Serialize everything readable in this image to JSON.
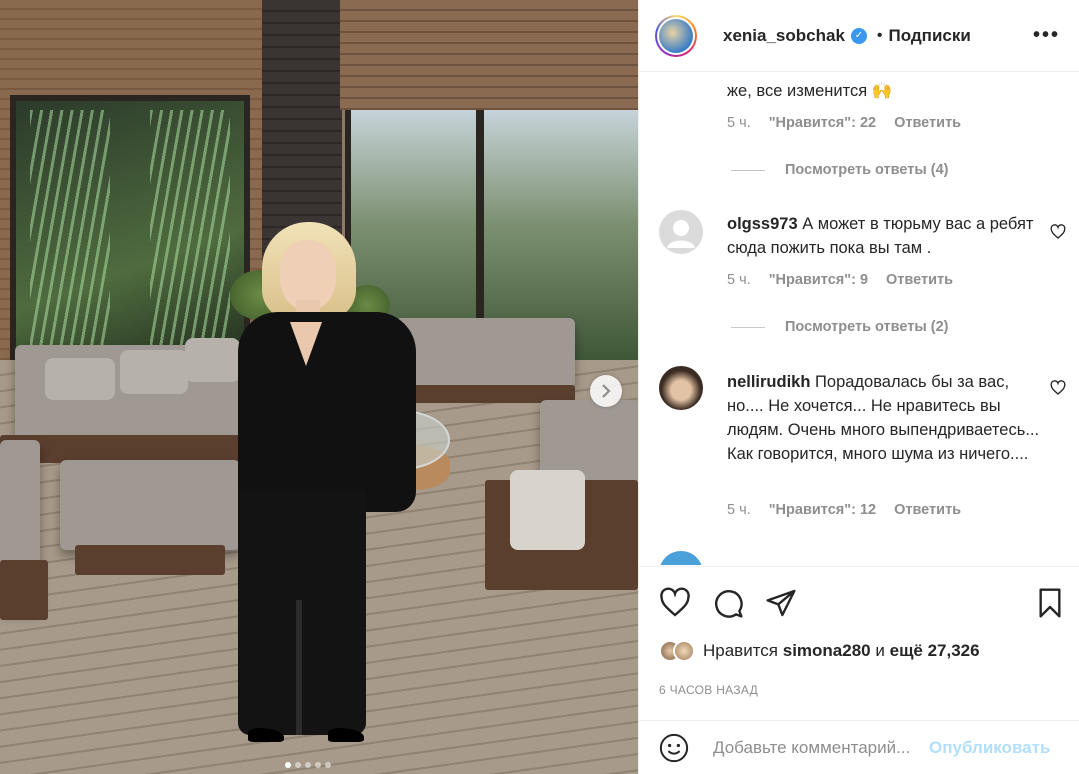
{
  "post": {
    "author": "xenia_sobchak",
    "follow_label": "Подписки",
    "bullet": "•",
    "more_label": "•••",
    "carousel_dots": 5,
    "carousel_active_index": 0
  },
  "comments": [
    {
      "text_tail": "же, все изменится 🙌",
      "time": "5 ч.",
      "likes": "\"Нравится\": 22",
      "reply": "Ответить",
      "view_replies": "Посмотреть ответы (4)"
    },
    {
      "username": "olgss973",
      "text": "А может в тюрьму вас а ребят сюда пожить пока вы там .",
      "time": "5 ч.",
      "likes": "\"Нравится\": 9",
      "reply": "Ответить",
      "view_replies": "Посмотреть ответы (2)"
    },
    {
      "username": "nellirudikh",
      "text": "Порадовалась бы за вас, но.... Не хочется... Не нравитесь вы людям. Очень много выпендриваетесь... Как говорится, много шума из ничего....",
      "time": "5 ч.",
      "likes": "\"Нравится\": 12",
      "reply": "Ответить"
    }
  ],
  "likes_line": {
    "prefix": "Нравится",
    "user": "simona280",
    "connector": "и",
    "more": "ещё 27,326"
  },
  "time_ago": "6 ЧАСОВ НАЗАД",
  "add_comment": {
    "placeholder": "Добавьте комментарий...",
    "publish_label": "Опубликовать"
  },
  "colors": {
    "text": "#262626",
    "secondary": "#8e8e8e",
    "publish_disabled": "#b2dffc",
    "verified": "#3897f0"
  },
  "icons": [
    "heart-icon",
    "comment-icon",
    "share-icon",
    "bookmark-icon",
    "emoji-icon",
    "verified-badge-icon",
    "chevron-right-icon"
  ]
}
